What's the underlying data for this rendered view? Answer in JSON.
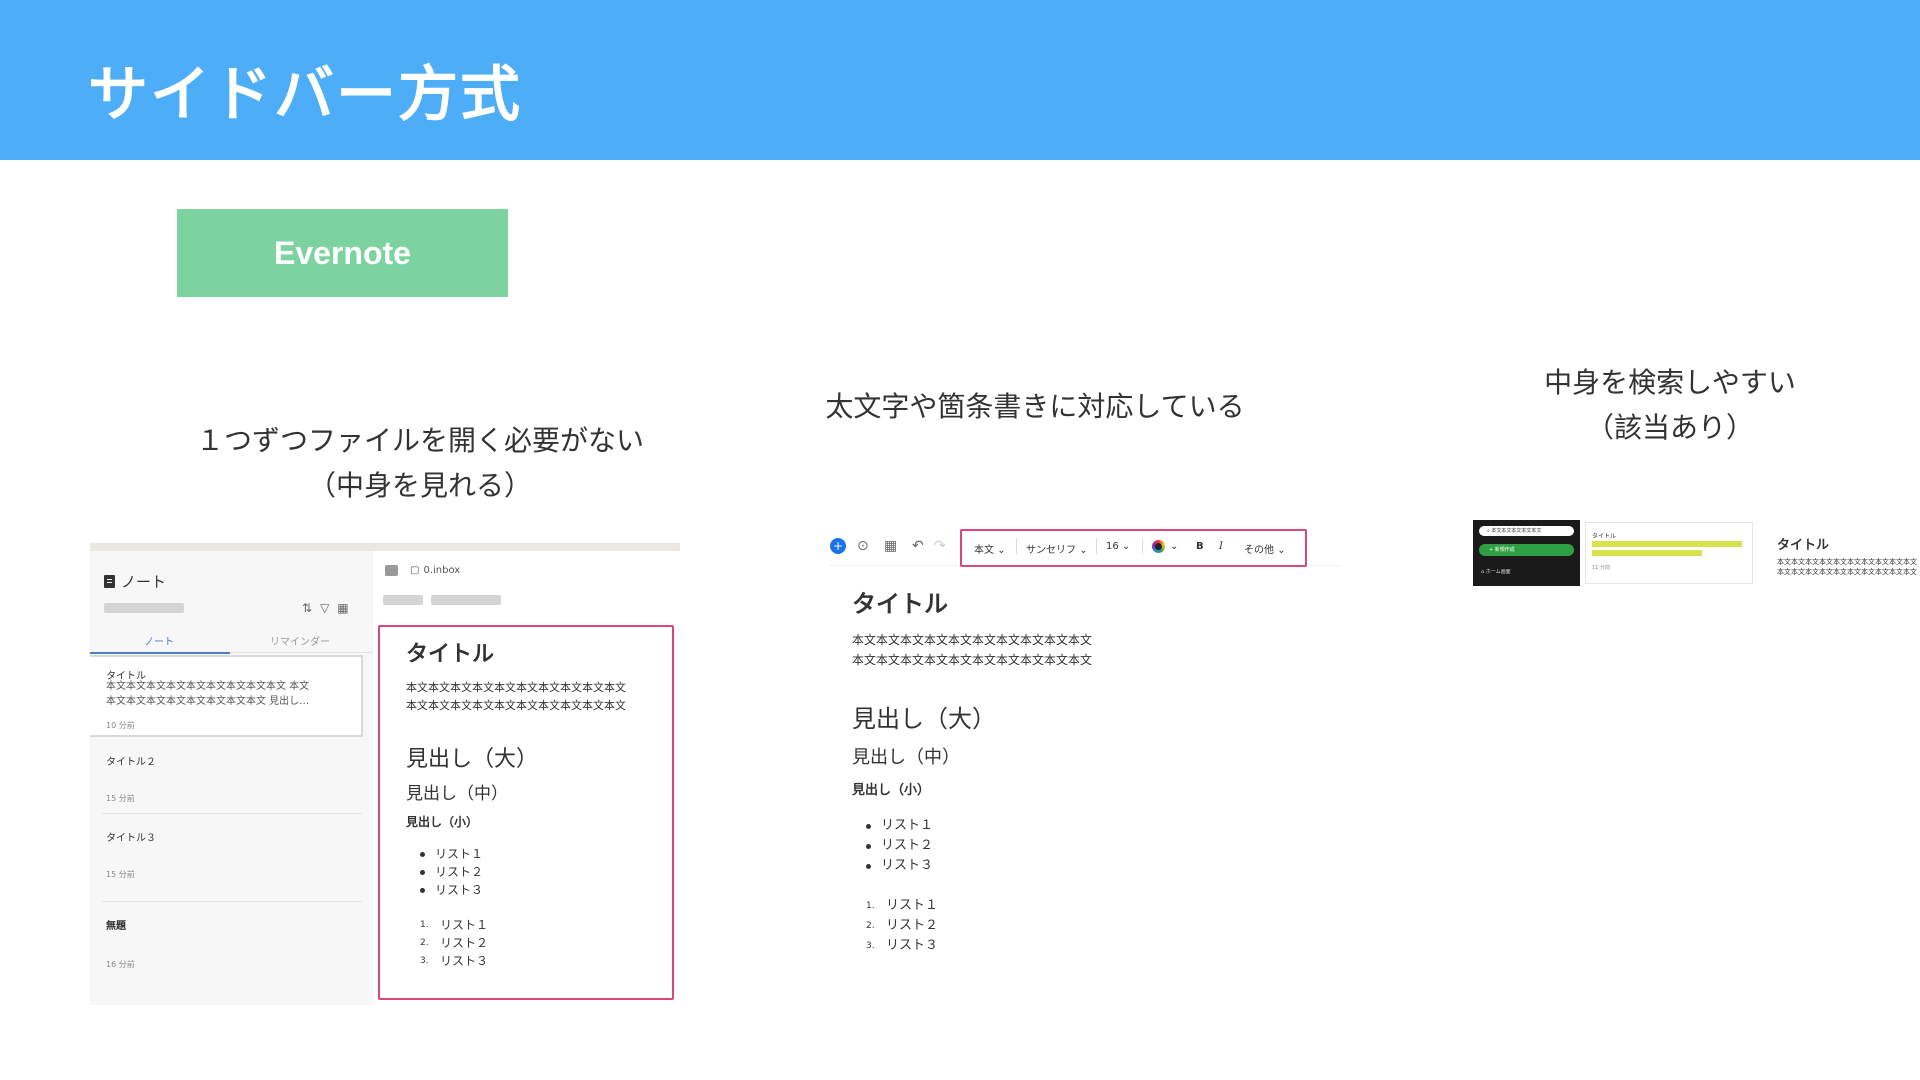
{
  "header": {
    "title": "サイドバー方式"
  },
  "app_badge": {
    "label": "Evernote"
  },
  "captions": {
    "c1_line1": "１つずつファイルを開く必要がない",
    "c1_line2": "（中身を見れる）",
    "c2": "太文字や箇条書きに対応している",
    "c3_line1": "中身を検索しやすい",
    "c3_line2": "（該当あり）"
  },
  "shot1": {
    "panel_title": "ノート",
    "tabs": {
      "notes": "ノート",
      "reminders": "リマインダー"
    },
    "notes": [
      {
        "title": "タイトル",
        "body1": "本文本文本文本文本文本文本文本文本文 本文",
        "body2": "本文本文本文本文本文本文本文本文 見出し…",
        "time": "10 分前"
      },
      {
        "title": "タイトル２",
        "time": "15 分前"
      },
      {
        "title": "タイトル３",
        "time": "15 分前"
      },
      {
        "title": "無題",
        "time": "16 分前"
      }
    ],
    "notebook": "0.inbox",
    "editor": {
      "title": "タイトル",
      "body1": "本文本文本文本文本文本文本文本文本文本文",
      "body2": "本文本文本文本文本文本文本文本文本文本文",
      "h_large": "見出し（大）",
      "h_medium": "見出し（中）",
      "h_small": "見出し（小）",
      "list": [
        "リスト１",
        "リスト２",
        "リスト３"
      ],
      "ordered": [
        "リスト１",
        "リスト２",
        "リスト３"
      ],
      "ordered_nums": [
        "1.",
        "2.",
        "3."
      ]
    }
  },
  "shot2": {
    "toolbar": {
      "style": "本文",
      "font": "サンセリフ",
      "size": "16",
      "bold": "B",
      "italic": "I",
      "more": "その他"
    },
    "editor": {
      "title": "タイトル",
      "body1": "本文本文本文本文本文本文本文本文本文本文",
      "body2": "本文本文本文本文本文本文本文本文本文本文",
      "h_large": "見出し（大）",
      "h_medium": "見出し（中）",
      "h_small": "見出し（小）",
      "list": [
        "リスト１",
        "リスト２",
        "リスト３"
      ],
      "ordered": [
        "リスト１",
        "リスト２",
        "リスト３"
      ],
      "ordered_nums": [
        "1.",
        "2.",
        "3."
      ]
    }
  },
  "shot3": {
    "search": "本文本文本文本文本文",
    "new_note": "新規作成",
    "home": "ホーム画面",
    "list_title": "タイトル",
    "list_time": "11 分前",
    "editor_title": "タイトル",
    "editor_body1": "本文本文本文本文本文本文本文本文本文本文",
    "editor_body2": "本文本文本文本文本文本文本文本文本文本文"
  },
  "colors": {
    "header_bg": "#4dadf7",
    "badge_bg": "#7dd3a0",
    "highlight_border": "#d9467a",
    "search_highlight": "#d7e34a",
    "new_button": "#2ea043"
  }
}
